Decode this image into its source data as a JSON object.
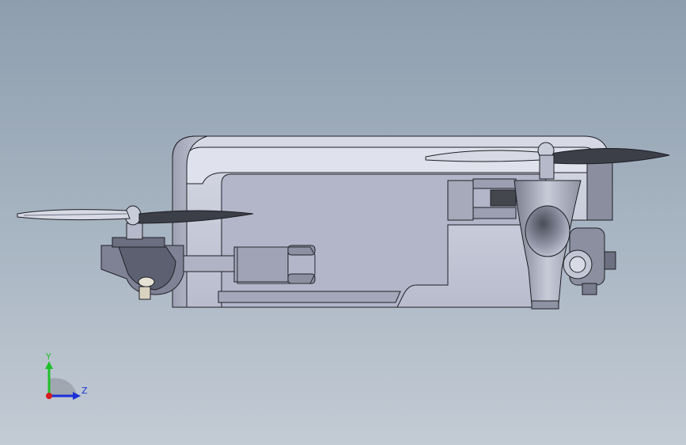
{
  "viewport": {
    "background_top": "#8e9eae",
    "background_bottom": "#c3cbd4"
  },
  "model": {
    "body_color": "#c2c5d6",
    "body_dark": "#5d5f6e",
    "edge_color": "#1e1f26",
    "propeller_color": "#d7dae4",
    "propeller_dark": "#3c3e48"
  },
  "triad": {
    "y_label": "Y",
    "z_label": "Z",
    "y_color": "#1fbf2a",
    "z_color": "#1b2fd6",
    "x_color": "#d81b1b"
  }
}
